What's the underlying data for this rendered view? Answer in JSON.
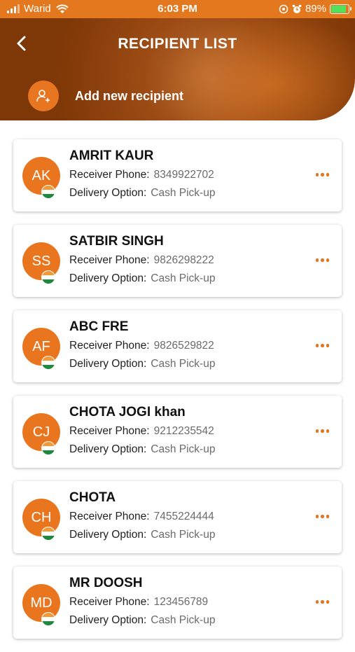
{
  "status_bar": {
    "carrier": "Warid",
    "time": "6:03 PM",
    "battery": "89%",
    "battery_fraction": 0.89
  },
  "header": {
    "title": "RECIPIENT LIST",
    "add_label": "Add new recipient"
  },
  "labels": {
    "phone": "Receiver Phone:",
    "delivery": "Delivery Option:"
  },
  "recipients": [
    {
      "initials": "AK",
      "name": "AMRIT KAUR",
      "phone": "8349922702",
      "delivery": "Cash Pick-up"
    },
    {
      "initials": "SS",
      "name": "SATBIR SINGH",
      "phone": "9826298222",
      "delivery": "Cash Pick-up"
    },
    {
      "initials": "AF",
      "name": "ABC FRE",
      "phone": "9826529822",
      "delivery": "Cash Pick-up"
    },
    {
      "initials": "CJ",
      "name": "CHOTA JOGI khan",
      "phone": "9212235542",
      "delivery": "Cash Pick-up"
    },
    {
      "initials": "CH",
      "name": "CHOTA",
      "phone": "7455224444",
      "delivery": "Cash Pick-up"
    },
    {
      "initials": "MD",
      "name": "MR DOOSH",
      "phone": "123456789",
      "delivery": "Cash Pick-up"
    }
  ],
  "colors": {
    "accent": "#e9761e",
    "header_dark": "#7e3707"
  }
}
